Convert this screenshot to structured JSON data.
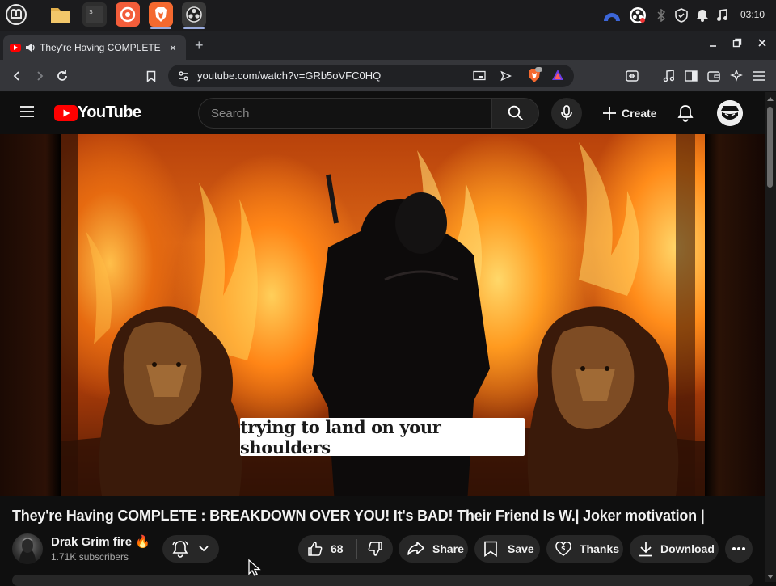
{
  "os": {
    "clock": "03:10",
    "apps": [
      "menu-icon",
      "files-icon",
      "terminal-icon",
      "firefox-icon",
      "brave-icon",
      "obs-icon"
    ],
    "tray": [
      "vpn-icon",
      "obs-tray-icon",
      "bluetooth-icon",
      "shield-icon",
      "notifications-icon",
      "music-icon"
    ]
  },
  "browser": {
    "tab": {
      "title": "They're Having COMPLETE",
      "close": "×"
    },
    "new_tab": "+",
    "url": "youtube.com/watch?v=GRb5oVFC0HQ"
  },
  "youtube": {
    "logo": "YouTube",
    "search_placeholder": "Search",
    "create_label": "Create"
  },
  "video": {
    "caption": "trying to land on your shoulders",
    "title": "They're Having COMPLETE : BREAKDOWN OVER YOU! It's BAD! Their Friend Is W.| Joker motivation |",
    "channel": "Drak Grim fire 🔥",
    "subscribers": "1.71K subscribers",
    "likes": "68",
    "share_label": "Share",
    "save_label": "Save",
    "thanks_label": "Thanks",
    "download_label": "Download"
  },
  "colors": {
    "yt_red": "#ff0000",
    "background": "#0f0f0f",
    "pill": "#272727"
  }
}
